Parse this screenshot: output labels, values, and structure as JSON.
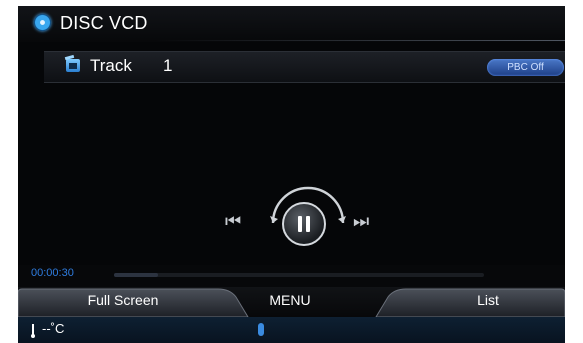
{
  "header": {
    "title": "DISC VCD",
    "icon": "disc-icon"
  },
  "track": {
    "label": "Track",
    "number": "1",
    "icon": "track-icon",
    "pbc_label": "PBC Off"
  },
  "controls": {
    "prev": "⏮",
    "next": "⏭",
    "state": "paused"
  },
  "progress": {
    "time": "00:00:30",
    "fraction": 0.12
  },
  "tabs": {
    "full_screen": "Full Screen",
    "menu": "MENU",
    "list": "List"
  },
  "status": {
    "temperature": "--˚C",
    "bluetooth_icon": "bluetooth-icon"
  },
  "colors": {
    "accent": "#2f7de0",
    "background": "#050608"
  }
}
